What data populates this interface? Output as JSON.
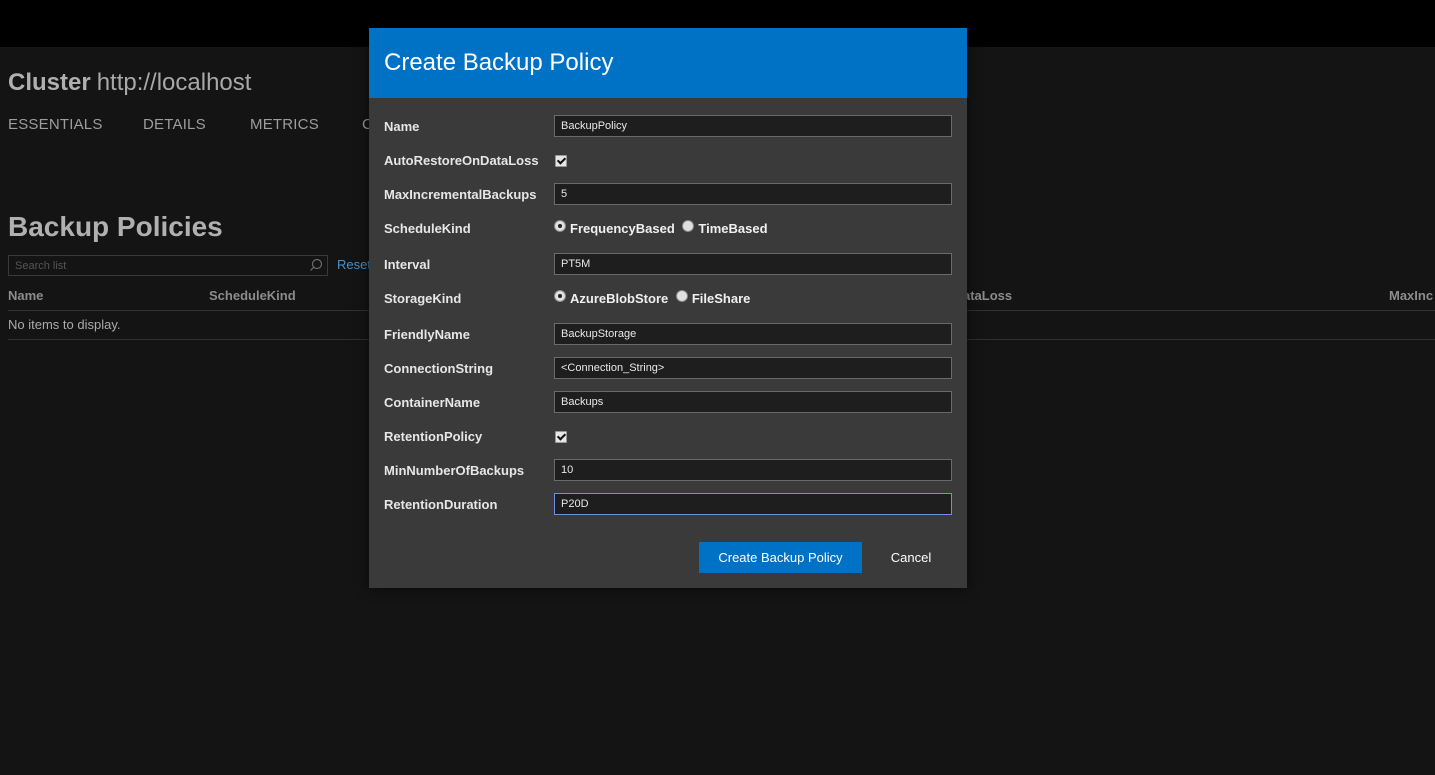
{
  "page": {
    "cluster_label": "Cluster",
    "cluster_url": "http://localhost",
    "tabs": [
      "ESSENTIALS",
      "DETAILS",
      "METRICS",
      "C"
    ],
    "section_title": "Backup Policies",
    "search_placeholder": "Search list",
    "reset_label": "Reset",
    "columns": [
      "Name",
      "ScheduleKind",
      "ataLoss",
      "MaxInc"
    ],
    "empty_text": "No items to display."
  },
  "dialog": {
    "title": "Create Backup Policy",
    "fields": {
      "name": {
        "label": "Name",
        "value": "BackupPolicy"
      },
      "auto_restore": {
        "label": "AutoRestoreOnDataLoss",
        "checked": true
      },
      "max_incremental": {
        "label": "MaxIncrementalBackups",
        "value": "5"
      },
      "schedule_kind": {
        "label": "ScheduleKind",
        "options": [
          "FrequencyBased",
          "TimeBased"
        ],
        "selected": "FrequencyBased"
      },
      "interval": {
        "label": "Interval",
        "value": "PT5M"
      },
      "storage_kind": {
        "label": "StorageKind",
        "options": [
          "AzureBlobStore",
          "FileShare"
        ],
        "selected": "AzureBlobStore"
      },
      "friendly_name": {
        "label": "FriendlyName",
        "value": "BackupStorage"
      },
      "connection_string": {
        "label": "ConnectionString",
        "value": "<Connection_String>"
      },
      "container_name": {
        "label": "ContainerName",
        "value": "Backups"
      },
      "retention_policy": {
        "label": "RetentionPolicy",
        "checked": true
      },
      "min_backups": {
        "label": "MinNumberOfBackups",
        "value": "10"
      },
      "retention_duration": {
        "label": "RetentionDuration",
        "value": "P20D"
      }
    },
    "create_button": "Create Backup Policy",
    "cancel_button": "Cancel"
  },
  "colors": {
    "accent": "#0072c6",
    "dialog_bg": "#3a3a3a",
    "page_bg": "#141414"
  }
}
